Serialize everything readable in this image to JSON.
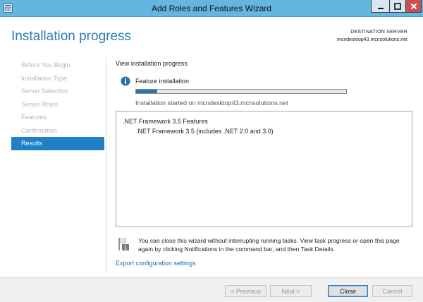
{
  "window": {
    "title": "Add Roles and Features Wizard",
    "controls": {
      "minimize": "_",
      "maximize": "□",
      "close": "X"
    }
  },
  "header": {
    "page_title": "Installation progress",
    "destination_label": "DESTINATION SERVER",
    "destination_value": "mcndesktop43.mcnsolutions.net"
  },
  "sidebar": {
    "items": [
      {
        "label": "Before You Begin",
        "active": false
      },
      {
        "label": "Installation Type",
        "active": false
      },
      {
        "label": "Server Selection",
        "active": false
      },
      {
        "label": "Server Roles",
        "active": false
      },
      {
        "label": "Features",
        "active": false
      },
      {
        "label": "Confirmation",
        "active": false
      },
      {
        "label": "Results",
        "active": true
      }
    ]
  },
  "main": {
    "section_title": "View installation progress",
    "feature_label": "Feature installation",
    "progress_fraction": 0.1,
    "started_text": "Installation started on mcndesktop43.mcnsolutions.net",
    "results": {
      "feature_name": ".NET Framework 3.5 Features",
      "sub_feature": ".NET Framework 3.5 (includes .NET 2.0 and 3.0)"
    },
    "note_badge": "1",
    "note_text": "You can close this wizard without interrupting running tasks. View task progress or open this page again by clicking Notifications in the command bar, and then Task Details.",
    "export_link": "Export configuration settings"
  },
  "footer": {
    "previous_label": "< Previous",
    "next_label": "Next >",
    "close_label": "Close",
    "cancel_label": "Cancel"
  },
  "colors": {
    "titlebar": "#64b5e0",
    "accent": "#1f80c7",
    "title_text": "#2c7fb0",
    "progress": "#2b76ad",
    "close_button": "#c75050"
  }
}
